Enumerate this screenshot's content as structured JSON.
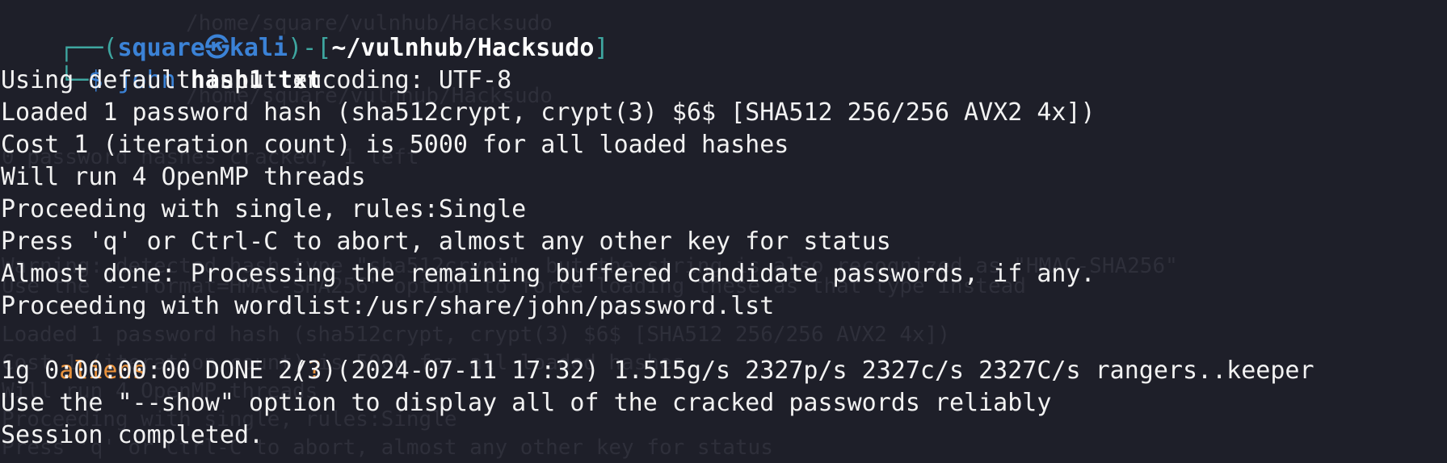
{
  "window": {
    "type": "terminal"
  },
  "prompt": {
    "frame_top_left": "┌──(",
    "user": "square",
    "separator_icon": "kali-skull-icon",
    "host": "kali",
    "frame_mid": ")-[",
    "cwd": "~/vulnhub/Hacksudo",
    "frame_end": "]",
    "frame_bottom_left": "└─",
    "dollar": "$",
    "command": "john",
    "argument": "hash1.txt"
  },
  "output": {
    "lines": [
      "Using default input encoding: UTF-8",
      "Loaded 1 password hash (sha512crypt, crypt(3) $6$ [SHA512 256/256 AVX2 4x])",
      "Cost 1 (iteration count) is 5000 for all loaded hashes",
      "Will run 4 OpenMP threads",
      "Proceeding with single, rules:Single",
      "Press 'q' or Ctrl-C to abort, almost any other key for status",
      "Almost done: Processing the remaining buffered candidate passwords, if any.",
      "Proceeding with wordlist:/usr/share/john/password.lst"
    ],
    "cracked": {
      "password": "aliens",
      "gap": "          ",
      "open": "(",
      "user": "?",
      "close": ")"
    },
    "status": "1g 0:00:00:00 DONE 2/3 (2024-07-11 17:32) 1.515g/s 2327p/s 2327c/s 2327C/s rangers..keeper",
    "hint": "Use the \"--show\" option to display all of the cracked passwords reliably",
    "session": "Session completed."
  },
  "colors": {
    "background": "#1e1f29",
    "text": "#f2f2f2",
    "prompt_frame": "#3ea6a0",
    "prompt_user": "#3b82d6",
    "cracked_password": "#e8923c"
  }
}
